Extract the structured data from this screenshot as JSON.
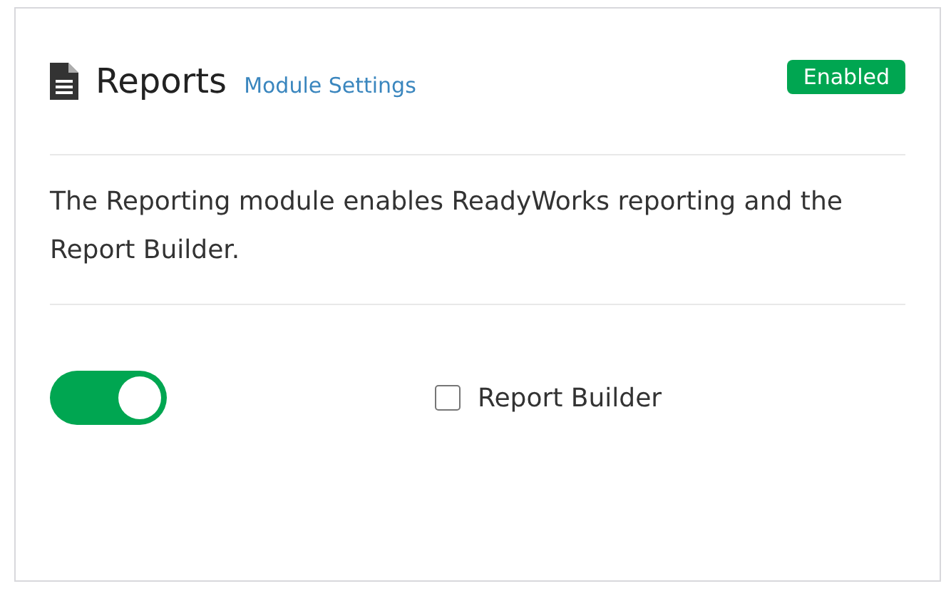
{
  "module": {
    "title": "Reports",
    "settings_link": "Module Settings",
    "status": {
      "label": "Enabled",
      "enabled": true
    },
    "description": "The Reporting module enables ReadyWorks reporting and the Report Builder.",
    "toggle": {
      "on": true
    },
    "options": [
      {
        "label": "Report Builder",
        "checked": false
      }
    ]
  }
}
